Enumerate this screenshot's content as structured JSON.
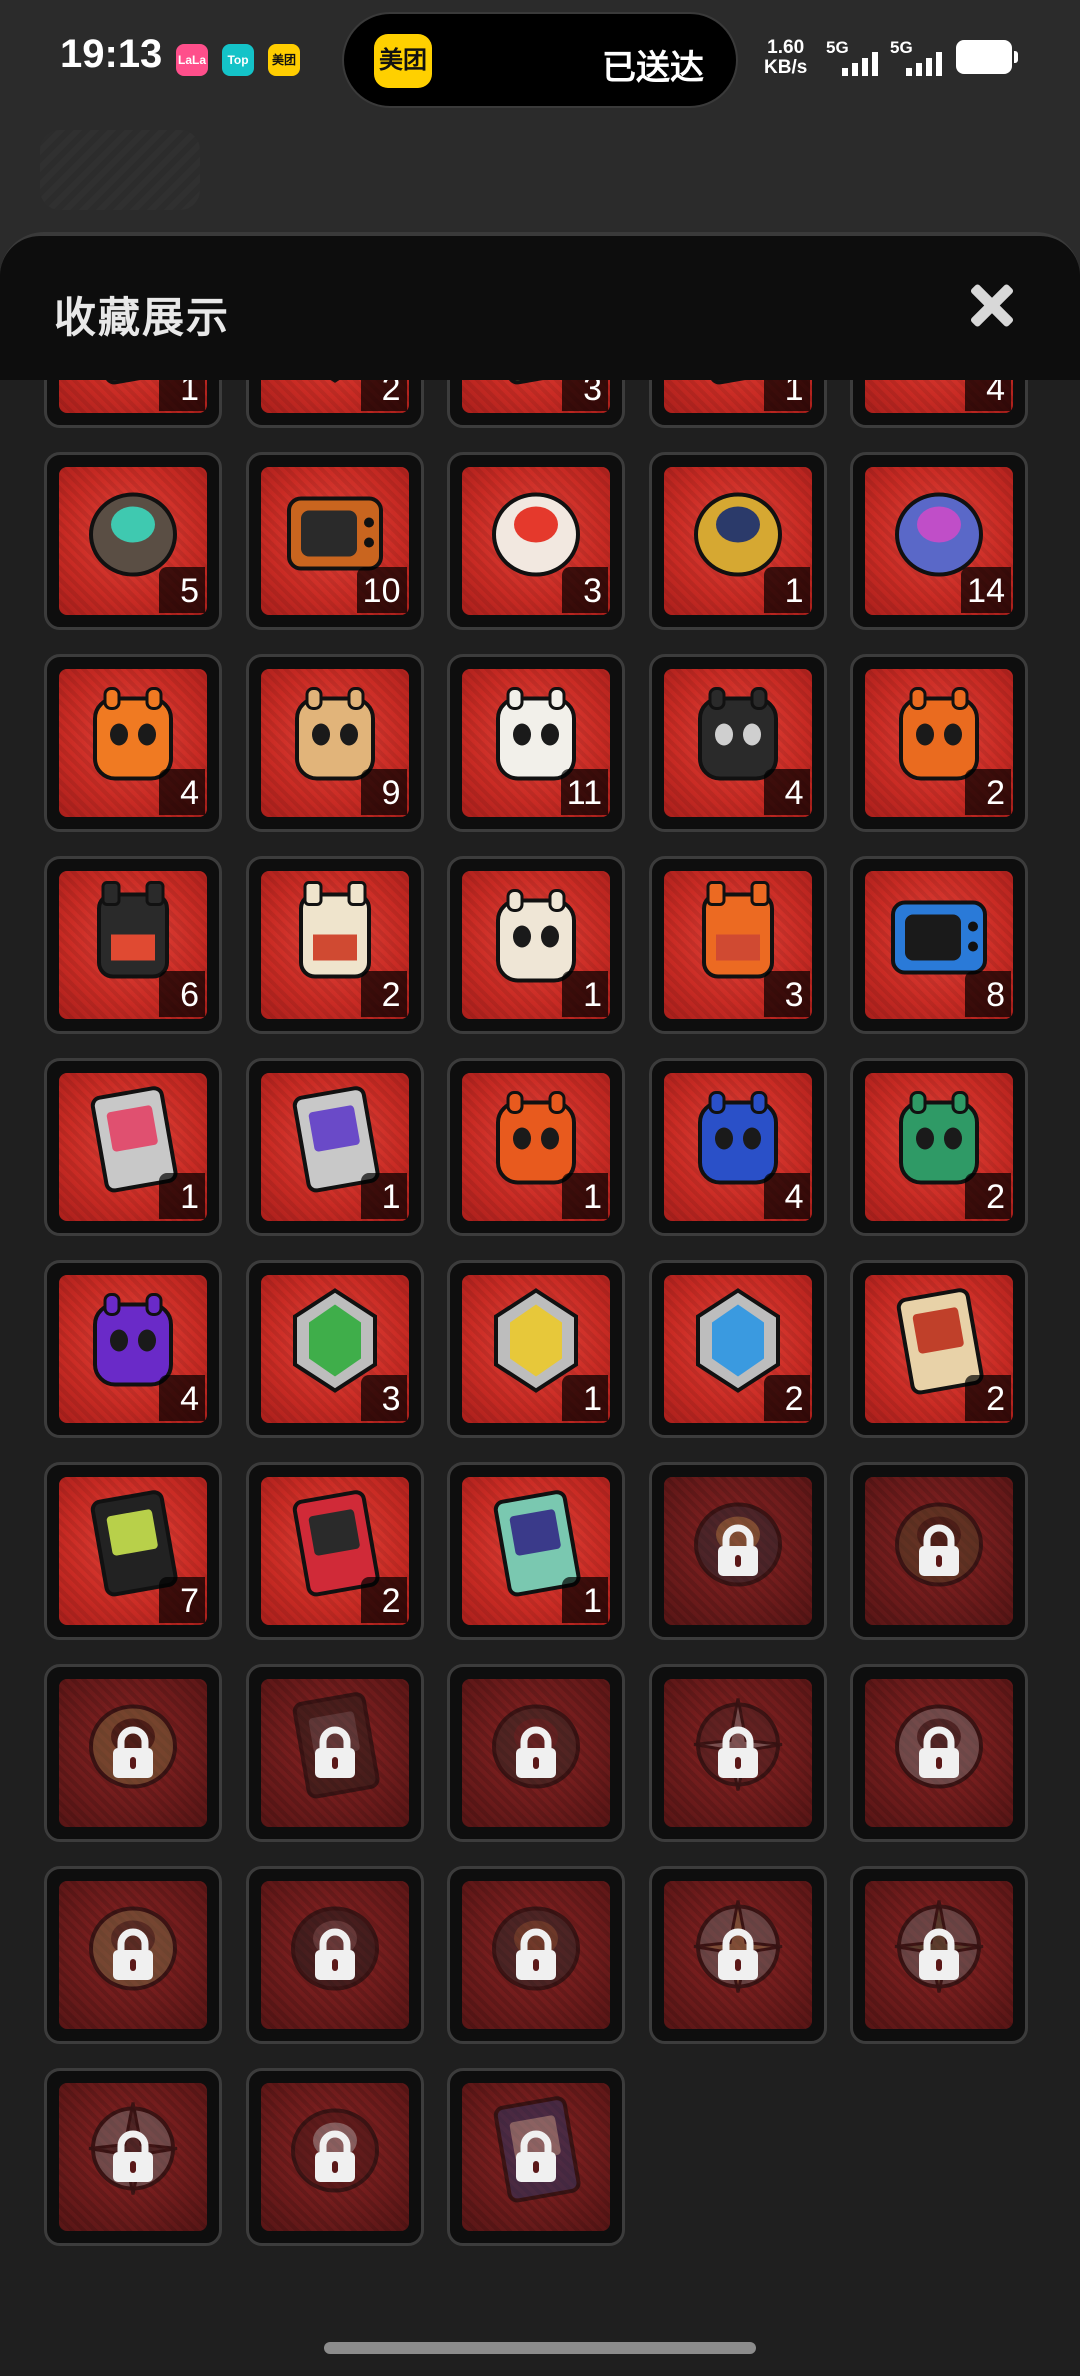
{
  "status_bar": {
    "time": "19:13",
    "app_icons": [
      {
        "label": "LaLa",
        "color": "#ff4f8b"
      },
      {
        "label": "Top",
        "color": "#14c3c8"
      },
      {
        "label": "美团",
        "color": "#ffcd00"
      }
    ],
    "notification": {
      "app": "美团",
      "text": "已送达"
    },
    "net_speed": "1.60",
    "net_unit": "KB/s",
    "signal_1": "5G",
    "signal_2": "5G"
  },
  "panel": {
    "title": "收藏展示",
    "close_label": "close"
  },
  "items": [
    {
      "icon": "frame-portrait",
      "count": "1",
      "locked": false
    },
    {
      "icon": "gold-geode",
      "count": "2",
      "locked": false
    },
    {
      "icon": "camo-frame",
      "count": "3",
      "locked": false
    },
    {
      "icon": "green-frame",
      "count": "1",
      "locked": false
    },
    {
      "icon": "retro-device",
      "count": "4",
      "locked": false
    },
    {
      "icon": "necklace-bust",
      "count": "5",
      "locked": false
    },
    {
      "icon": "orange-tv",
      "count": "10",
      "locked": false
    },
    {
      "icon": "cash-register",
      "count": "3",
      "locked": false
    },
    {
      "icon": "gold-horn",
      "count": "1",
      "locked": false
    },
    {
      "icon": "crystal-butterfly",
      "count": "14",
      "locked": false
    },
    {
      "icon": "orange-can-bangboo",
      "count": "4",
      "locked": false
    },
    {
      "icon": "cookie-bangboo",
      "count": "9",
      "locked": false
    },
    {
      "icon": "popsicle-bangboo",
      "count": "11",
      "locked": false
    },
    {
      "icon": "black-bunny-bangboo",
      "count": "4",
      "locked": false
    },
    {
      "icon": "orange-bunny-bangboo",
      "count": "2",
      "locked": false
    },
    {
      "icon": "black-robot",
      "count": "6",
      "locked": false
    },
    {
      "icon": "cream-robot",
      "count": "2",
      "locked": false
    },
    {
      "icon": "cream-bunny-bangboo",
      "count": "1",
      "locked": false
    },
    {
      "icon": "orange-robot",
      "count": "3",
      "locked": false
    },
    {
      "icon": "blue-tv",
      "count": "8",
      "locked": false
    },
    {
      "icon": "pink-stamp",
      "count": "1",
      "locked": false
    },
    {
      "icon": "purple-stamp",
      "count": "1",
      "locked": false
    },
    {
      "icon": "orange-noodle-cup",
      "count": "1",
      "locked": false
    },
    {
      "icon": "blue-noodle-cup",
      "count": "4",
      "locked": false
    },
    {
      "icon": "green-noodle-cup",
      "count": "2",
      "locked": false
    },
    {
      "icon": "purple-noodle-cup",
      "count": "4",
      "locked": false
    },
    {
      "icon": "green-gem",
      "count": "3",
      "locked": false
    },
    {
      "icon": "yellow-gem",
      "count": "1",
      "locked": false
    },
    {
      "icon": "blue-gem",
      "count": "2",
      "locked": false
    },
    {
      "icon": "tops-card-beige",
      "count": "2",
      "locked": false
    },
    {
      "icon": "tops-card-black",
      "count": "7",
      "locked": false
    },
    {
      "icon": "tops-card-red",
      "count": "2",
      "locked": false
    },
    {
      "icon": "holo-card",
      "count": "1",
      "locked": false
    },
    {
      "icon": "bunny-figure",
      "count": "",
      "locked": true
    },
    {
      "icon": "swirl-pile",
      "count": "",
      "locked": true
    },
    {
      "icon": "gold-figure",
      "count": "",
      "locked": true
    },
    {
      "icon": "dark-frame",
      "count": "",
      "locked": true
    },
    {
      "icon": "bust",
      "count": "",
      "locked": true
    },
    {
      "icon": "silver-badge",
      "count": "",
      "locked": true
    },
    {
      "icon": "cat-emblem",
      "count": "",
      "locked": true
    },
    {
      "icon": "gold-medallion",
      "count": "",
      "locked": true
    },
    {
      "icon": "dark-heart",
      "count": "",
      "locked": true
    },
    {
      "icon": "helmet",
      "count": "",
      "locked": true
    },
    {
      "icon": "gold-sword-badge",
      "count": "",
      "locked": true
    },
    {
      "icon": "green-sword-badge",
      "count": "",
      "locked": true
    },
    {
      "icon": "dark-sword-badge",
      "count": "",
      "locked": true
    },
    {
      "icon": "red-emblem",
      "count": "",
      "locked": true
    },
    {
      "icon": "blue-card",
      "count": "",
      "locked": true
    }
  ]
}
